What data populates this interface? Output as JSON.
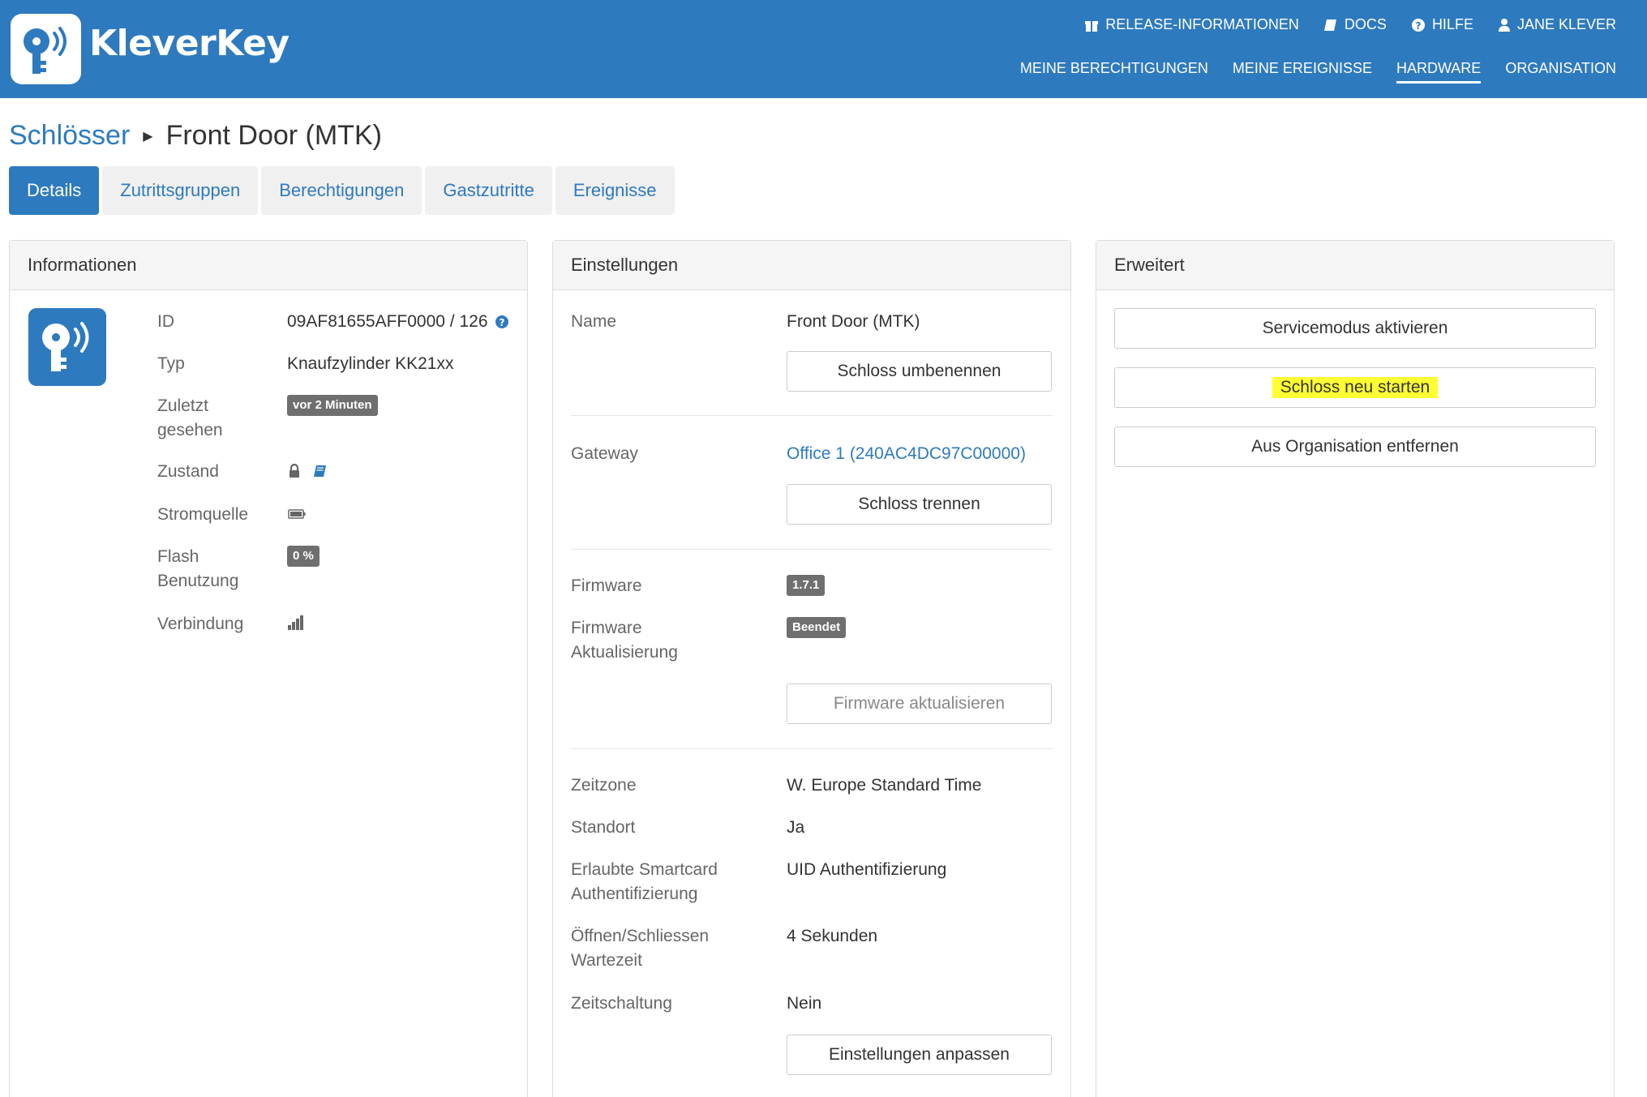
{
  "app": {
    "name": "KleverKey",
    "brand_color": "#2e7abf"
  },
  "header": {
    "top_links": [
      "RELEASE-INFORMATIONEN",
      "DOCS",
      "HILFE",
      "JANE KLEVER"
    ],
    "nav": [
      "MEINE BERECHTIGUNGEN",
      "MEINE EREIGNISSE",
      "HARDWARE",
      "ORGANISATION"
    ],
    "active_nav": "HARDWARE"
  },
  "breadcrumb": {
    "parent": "Schlösser",
    "current": "Front Door (MTK)"
  },
  "tabs": [
    "Details",
    "Zutrittsgruppen",
    "Berechtigungen",
    "Gastzutritte",
    "Ereignisse"
  ],
  "active_tab": "Details",
  "info": {
    "title": "Informationen",
    "id_label": "ID",
    "id_value": "09AF81655AFF0000 / 126",
    "typ_label": "Typ",
    "typ_value": "Knaufzylinder KK21xx",
    "last_seen_label_1": "Zuletzt",
    "last_seen_label_2": "gesehen",
    "last_seen_value": "vor 2 Minuten",
    "zustand_label": "Zustand",
    "strom_label": "Stromquelle",
    "flash_label_1": "Flash",
    "flash_label_2": "Benutzung",
    "flash_value": "0 %",
    "verbindung_label": "Verbindung"
  },
  "settings": {
    "title": "Einstellungen",
    "name_label": "Name",
    "name_value": "Front Door (MTK)",
    "rename_button": "Schloss umbenennen",
    "gateway_label": "Gateway",
    "gateway_value": "Office 1 (240AC4DC97C00000)",
    "disconnect_button": "Schloss trennen",
    "firmware_label": "Firmware",
    "firmware_value": "1.7.1",
    "fw_update_label_1": "Firmware",
    "fw_update_label_2": "Aktualisierung",
    "fw_update_value": "Beendet",
    "fw_update_button": "Firmware aktualisieren",
    "timezone_label": "Zeitzone",
    "timezone_value": "W. Europe Standard Time",
    "standort_label": "Standort",
    "standort_value": "Ja",
    "smartcard_label_1": "Erlaubte Smartcard",
    "smartcard_label_2": "Authentifizierung",
    "smartcard_value": "UID Authentifizierung",
    "open_label_1": "Öffnen/Schliessen",
    "open_label_2": "Wartezeit",
    "open_value": "4 Sekunden",
    "timer_label": "Zeitschaltung",
    "timer_value": "Nein",
    "adjust_button": "Einstellungen anpassen"
  },
  "advanced": {
    "title": "Erweitert",
    "service_button": "Servicemodus aktivieren",
    "restart_button": "Schloss neu starten",
    "remove_button": "Aus Organisation entfernen"
  }
}
